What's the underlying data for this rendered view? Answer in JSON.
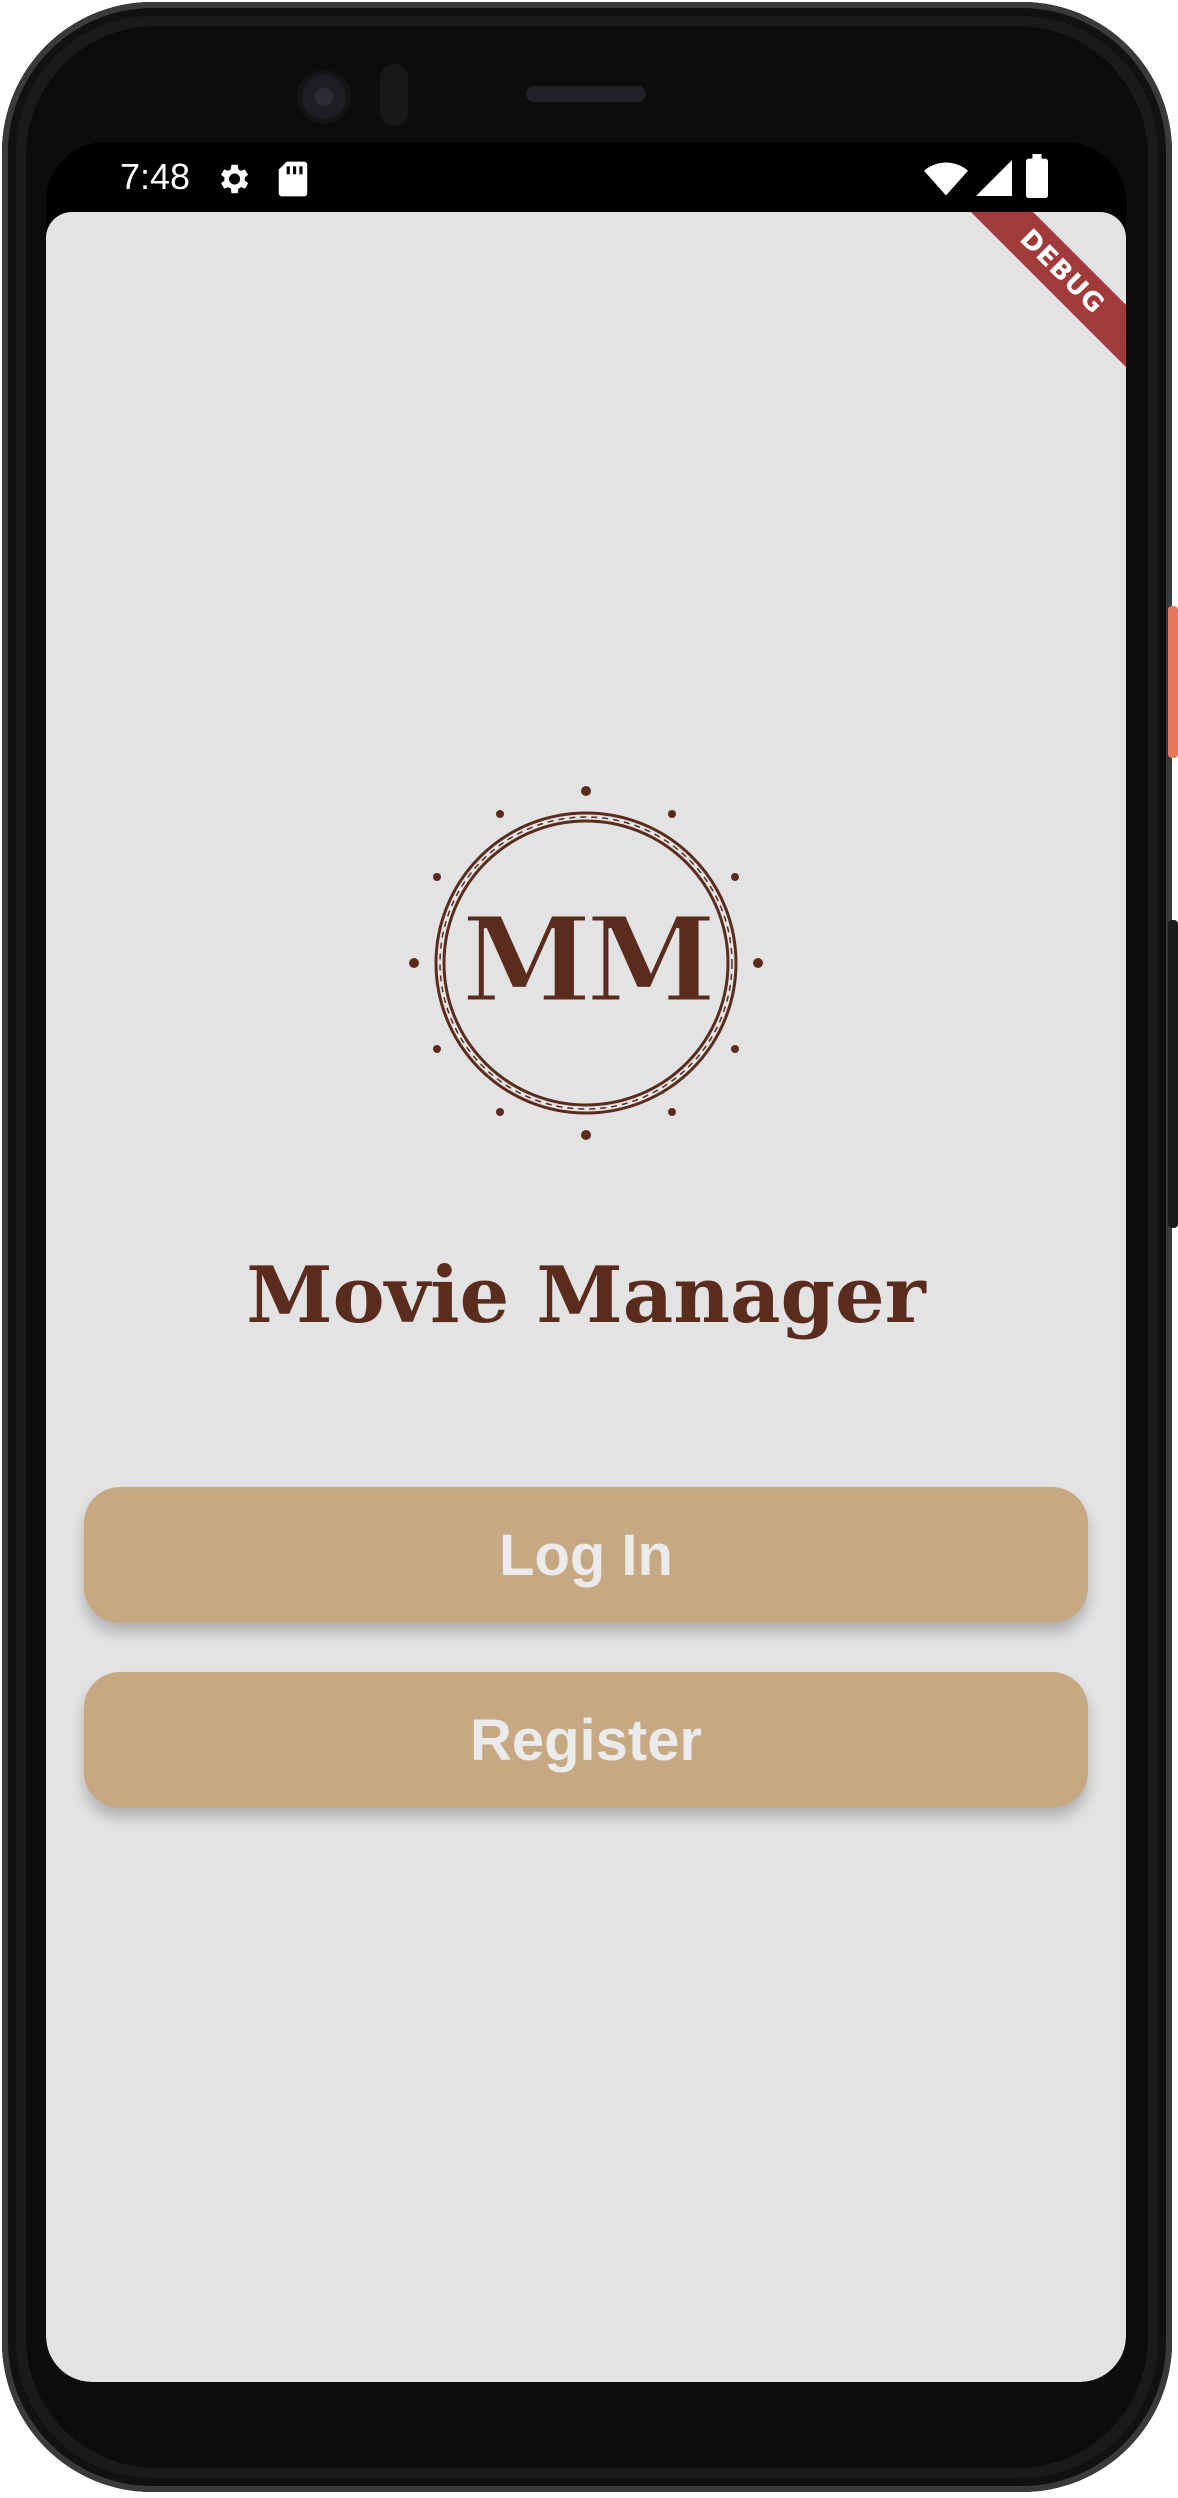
{
  "status_bar": {
    "time": "7:48",
    "icons": [
      "gear-icon",
      "sd-card-icon",
      "wifi-icon",
      "cell-signal-icon",
      "battery-icon"
    ]
  },
  "debug_banner": {
    "label": "DEBUG"
  },
  "logo": {
    "text": "MM",
    "color": "#5a2c1d"
  },
  "app": {
    "title": "Movie Manager",
    "background": "#e4e3e4",
    "accent": "#c6a883"
  },
  "actions": {
    "login_label": "Log In",
    "register_label": "Register"
  }
}
